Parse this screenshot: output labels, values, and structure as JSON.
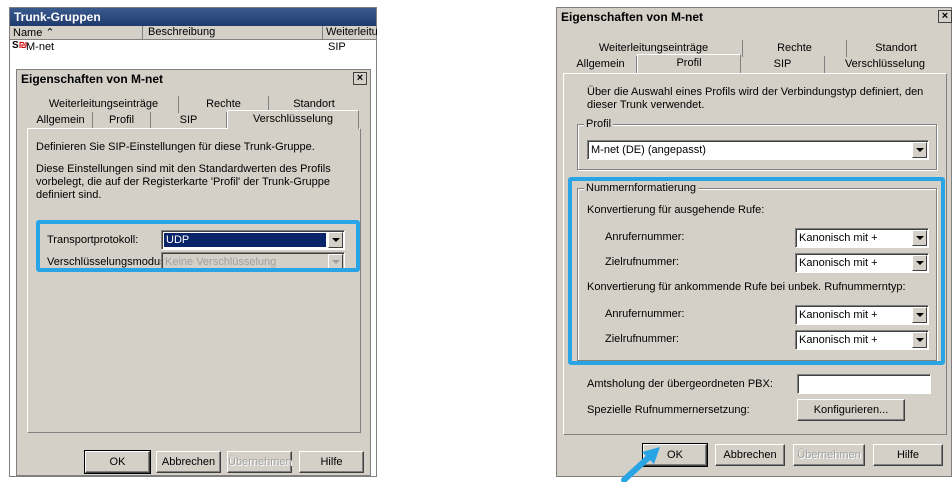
{
  "left": {
    "bg_window_title": "Trunk-Gruppen",
    "list_header": {
      "name": "Name",
      "description": "Beschreibung",
      "forward": "Weiterleitu"
    },
    "list_row": {
      "name": "M-net",
      "forward": "SIP"
    },
    "dialog_title": "Eigenschaften von M-net",
    "tabs_back": [
      "Weiterleitungseinträge",
      "Rechte",
      "Standort"
    ],
    "tabs_front": [
      "Allgemein",
      "Profil",
      "SIP",
      "Verschlüsselung"
    ],
    "selected_tab": "Verschlüsselung",
    "intro1": "Definieren Sie SIP-Einstellungen für diese Trunk-Gruppe.",
    "intro2": "Diese Einstellungen sind mit den Standardwerten des Profils vorbelegt, die auf der Registerkarte 'Profil' der Trunk-Gruppe definiert sind.",
    "transport_label": "Transportprotokoll:",
    "transport_value": "UDP",
    "encryption_label": "Verschlüsselungsmodus:",
    "encryption_value": "Keine Verschlüsselung",
    "buttons": {
      "ok": "OK",
      "cancel": "Abbrechen",
      "apply": "Übernehmen",
      "help": "Hilfe"
    }
  },
  "right": {
    "dialog_title": "Eigenschaften von M-net",
    "tabs_back": [
      "Weiterleitungseinträge",
      "Rechte",
      "Standort"
    ],
    "tabs_front": [
      "Allgemein",
      "Profil",
      "SIP",
      "Verschlüsselung"
    ],
    "selected_tab": "Profil",
    "intro": "Über die Auswahl eines Profils wird der Verbindungstyp definiert, den dieser Trunk verwendet.",
    "profile_group": "Profil",
    "profile_value": "M-net (DE) (angepasst)",
    "numfmt_group": "Nummernformatierung",
    "outgoing_heading": "Konvertierung für ausgehende Rufe:",
    "incoming_heading": "Konvertierung für ankommende Rufe bei unbek. Rufnummerntyp:",
    "caller_label": "Anrufernummer:",
    "dest_label": "Zielrufnummer:",
    "combo_value": "Kanonisch mit +",
    "pbx_label": "Amtsholung der übergeordneten PBX:",
    "special_label": "Spezielle Rufnummernersetzung:",
    "configure_button": "Konfigurieren...",
    "buttons": {
      "ok": "OK",
      "cancel": "Abbrechen",
      "apply": "Übernehmen",
      "help": "Hilfe"
    }
  },
  "colors": {
    "highlight": "#29a4e5",
    "titlebar": "#1f3b6e",
    "dialog_bg": "#d4d0c8"
  }
}
